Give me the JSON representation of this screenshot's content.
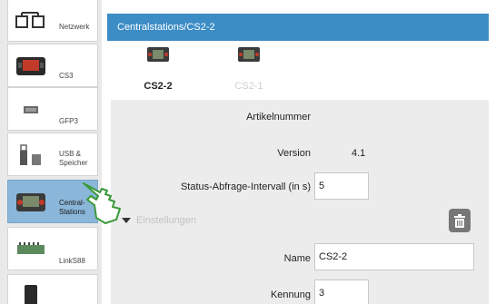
{
  "sidebar": {
    "items": [
      {
        "label": "Netzwerk"
      },
      {
        "label": "CS3"
      },
      {
        "label": "GFP3"
      },
      {
        "label": "USB &\nSpeicher"
      },
      {
        "label": "Central-\nStations"
      },
      {
        "label": "LinkS88"
      },
      {
        "label": ""
      }
    ]
  },
  "header": {
    "title": "Centralstations/CS2-2"
  },
  "tabs": [
    {
      "label": "CS2-2"
    },
    {
      "label": "CS2-1"
    }
  ],
  "form": {
    "artikelnummer_label": "Artikelnummer",
    "version_label": "Version",
    "version_value": "4.1",
    "status_label": "Status-Abfrage-Intervall (in s)",
    "status_value": "5",
    "section_label": "Einstellungen",
    "name_label": "Name",
    "name_value": "CS2-2",
    "kennung_label": "Kennung",
    "kennung_value": "3"
  },
  "colors": {
    "accent": "#3c8cc6",
    "active_item": "#8ab6d9"
  },
  "icons": {
    "network": "network-icon",
    "cs3": "cs3-device-icon",
    "gfp3": "gfp3-module-icon",
    "usb": "usb-storage-icon",
    "centralstations": "central-station-icon",
    "links88": "links88-module-icon",
    "trash": "trash-icon",
    "pointer": "hand-pointer-icon"
  }
}
